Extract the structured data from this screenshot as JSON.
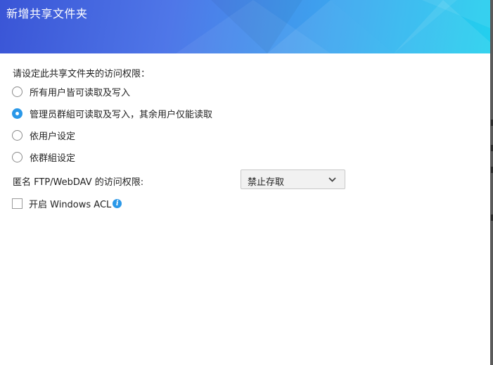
{
  "dialog": {
    "title": "新增共享文件夹"
  },
  "permissions": {
    "label": "请设定此共享文件夹的访问权限：",
    "options": [
      {
        "label": "所有用户皆可读取及写入",
        "checked": false
      },
      {
        "label": "管理员群組可读取及写入，其余用户仅能读取",
        "checked": true
      },
      {
        "label": "依用户设定",
        "checked": false
      },
      {
        "label": "依群組设定",
        "checked": false
      }
    ]
  },
  "ftp": {
    "label": "匿名 FTP/WebDAV 的访问权限:",
    "selected": "禁止存取"
  },
  "acl": {
    "label": "开启 Windows ACL",
    "checked": false
  },
  "colors": {
    "accent": "#2a98e8",
    "header_start": "#3a55d6",
    "header_end": "#23d0ee"
  },
  "icons": [
    "chevron-down-icon",
    "info-icon"
  ]
}
